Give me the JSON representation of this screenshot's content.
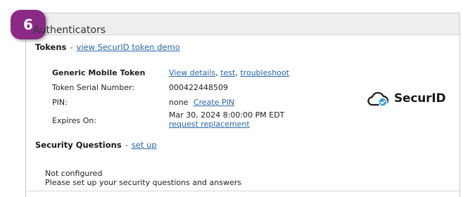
{
  "step_badge": "6",
  "panel": {
    "title": "Authenticators"
  },
  "tokens": {
    "heading": "Tokens",
    "separator": "-",
    "link": "view SecurID token demo",
    "token_name": "Generic Mobile Token",
    "actions": {
      "view_details": "View details",
      "comma1": ",",
      "test": "test",
      "comma2": ",",
      "troubleshoot": "troubleshoot"
    },
    "serial_label": "Token Serial Number:",
    "serial_value": "000422448509",
    "pin_label": "PIN:",
    "pin_value": "none",
    "create_pin": "Create PIN",
    "expires_label": "Expires On:",
    "expires_value": "Mar 30, 2024 8:00:00 PM EDT",
    "request_replacement": "request replacement"
  },
  "logo": {
    "text": "SecurID",
    "accent_color": "#2fa3da",
    "icon": "cloud-check-icon"
  },
  "security_questions": {
    "heading": "Security Questions",
    "separator": "-",
    "link": "set up",
    "status_line1": "Not configured",
    "status_line2": "Please set up your security questions and answers"
  },
  "colors": {
    "badge": "#8a2a86",
    "link": "#2766a9",
    "header_bg": "#eeeeee"
  }
}
